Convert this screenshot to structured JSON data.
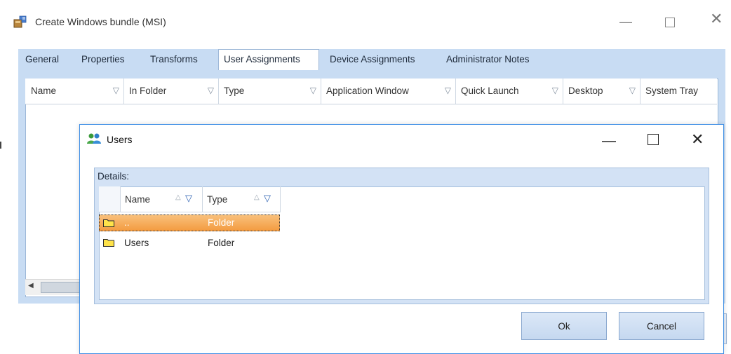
{
  "window": {
    "title": "Create Windows bundle (MSI)"
  },
  "tabs": [
    {
      "label": "General"
    },
    {
      "label": "Properties"
    },
    {
      "label": "Transforms"
    },
    {
      "label": "User Assignments",
      "active": true
    },
    {
      "label": "Device Assignments"
    },
    {
      "label": "Administrator Notes"
    }
  ],
  "grid": {
    "columns": [
      {
        "label": "Name"
      },
      {
        "label": "In Folder"
      },
      {
        "label": "Type"
      },
      {
        "label": "Application Window"
      },
      {
        "label": "Quick Launch"
      },
      {
        "label": "Desktop"
      },
      {
        "label": "System Tray"
      }
    ]
  },
  "dialog": {
    "title": "Users",
    "details_label": "Details:",
    "columns": [
      {
        "label": "Name"
      },
      {
        "label": "Type"
      }
    ],
    "rows": [
      {
        "name": "..",
        "type": "Folder",
        "selected": true
      },
      {
        "name": "Users",
        "type": "Folder",
        "selected": false
      }
    ],
    "ok_label": "Ok",
    "cancel_label": "Cancel"
  },
  "colors": {
    "accent": "#c8dcf3",
    "selection": "#f39a3e",
    "dialog_border": "#3d8ee5"
  }
}
